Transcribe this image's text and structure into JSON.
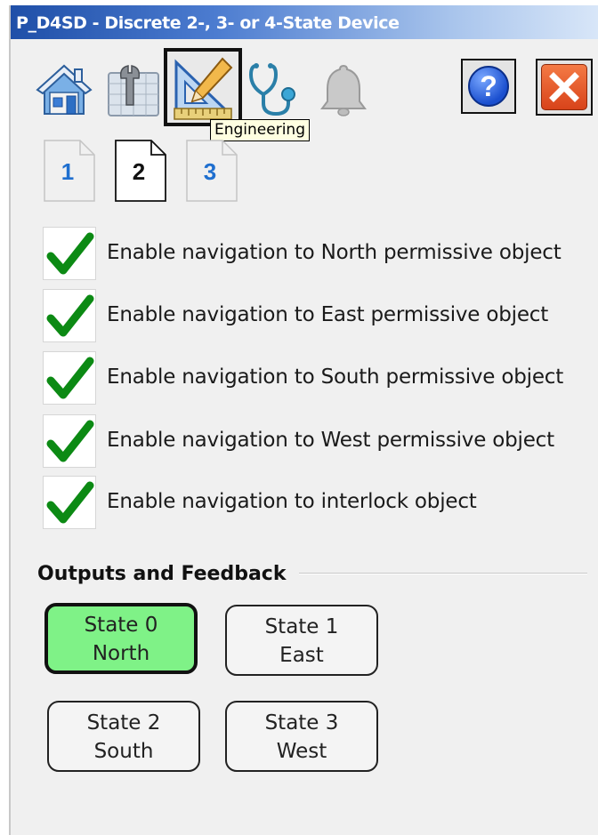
{
  "window": {
    "title": "P_D4SD - Discrete 2-, 3- or 4-State Device"
  },
  "toolbar": {
    "icons": [
      {
        "name": "home-icon"
      },
      {
        "name": "maintenance-icon"
      },
      {
        "name": "engineering-icon",
        "selected": true
      },
      {
        "name": "diagnostics-icon"
      },
      {
        "name": "alarm-bell-icon",
        "disabled": true
      }
    ],
    "help_label": "?",
    "tooltip": "Engineering"
  },
  "page_tabs": [
    {
      "label": "1",
      "active": false
    },
    {
      "label": "2",
      "active": true
    },
    {
      "label": "3",
      "active": false
    }
  ],
  "checkboxes": [
    {
      "label": "Enable navigation to North permissive object",
      "checked": true
    },
    {
      "label": "Enable navigation to East permissive object",
      "checked": true
    },
    {
      "label": "Enable navigation to South permissive object",
      "checked": true
    },
    {
      "label": "Enable navigation to West permissive object",
      "checked": true
    },
    {
      "label": "Enable navigation to interlock object",
      "checked": true
    }
  ],
  "outputs": {
    "title": "Outputs and Feedback",
    "states": [
      {
        "line1": "State 0",
        "line2": "North",
        "active": true
      },
      {
        "line1": "State 1",
        "line2": "East",
        "active": false
      },
      {
        "line1": "State 2",
        "line2": "South",
        "active": false
      },
      {
        "line1": "State 3",
        "line2": "West",
        "active": false
      }
    ]
  },
  "colors": {
    "active_state": "#7ff287",
    "check": "#0c8a14",
    "title_bar": "#1f4fa8",
    "close": "#e24a18",
    "help": "#1a4fcf"
  }
}
